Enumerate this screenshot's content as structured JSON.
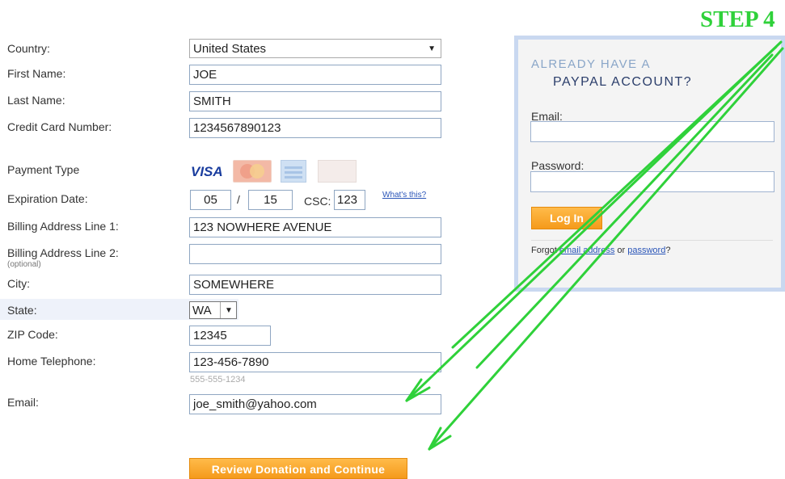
{
  "form": {
    "country": {
      "label": "Country:",
      "value": "United States"
    },
    "first_name": {
      "label": "First Name:",
      "value": "JOE"
    },
    "last_name": {
      "label": "Last Name:",
      "value": "SMITH"
    },
    "card_number": {
      "label": "Credit Card Number:",
      "value": "1234567890123"
    },
    "payment_type": {
      "label": "Payment Type",
      "cards": [
        "VISA",
        "mastercard",
        "amex",
        "discover"
      ]
    },
    "expiration": {
      "label": "Expiration Date:",
      "month": "05",
      "separator": "/",
      "year": "15",
      "csc_label": "CSC:",
      "csc": "123",
      "whats_this": "What's this?"
    },
    "address1": {
      "label": "Billing Address Line 1:",
      "value": "123 NOWHERE AVENUE"
    },
    "address2": {
      "label": "Billing Address Line 2:",
      "optional": "(optional)",
      "value": ""
    },
    "city": {
      "label": "City:",
      "value": "SOMEWHERE"
    },
    "state": {
      "label": "State:",
      "value": "WA"
    },
    "zip": {
      "label": "ZIP Code:",
      "value": "12345"
    },
    "phone": {
      "label": "Home Telephone:",
      "value": "123-456-7890",
      "hint": "555-555-1234"
    },
    "email": {
      "label": "Email:",
      "value": "joe_smith@yahoo.com"
    },
    "submit_label": "Review Donation and Continue"
  },
  "login_panel": {
    "heading_line1": "ALREADY HAVE A",
    "heading_line2": "PAYPAL ACCOUNT?",
    "email_label": "Email:",
    "password_label": "Password:",
    "login_button": "Log In",
    "forgot_prefix": "Forgot",
    "forgot_email_link": "email address",
    "forgot_or": "or",
    "forgot_password_link": "password",
    "forgot_suffix": "?"
  },
  "annotation": {
    "step_label": "STEP 4",
    "arrow_color": "#2fd13a"
  },
  "colors": {
    "accent_orange": "#f59a1b",
    "link_blue": "#2a55b8",
    "panel_border": "#c9d8f0"
  }
}
